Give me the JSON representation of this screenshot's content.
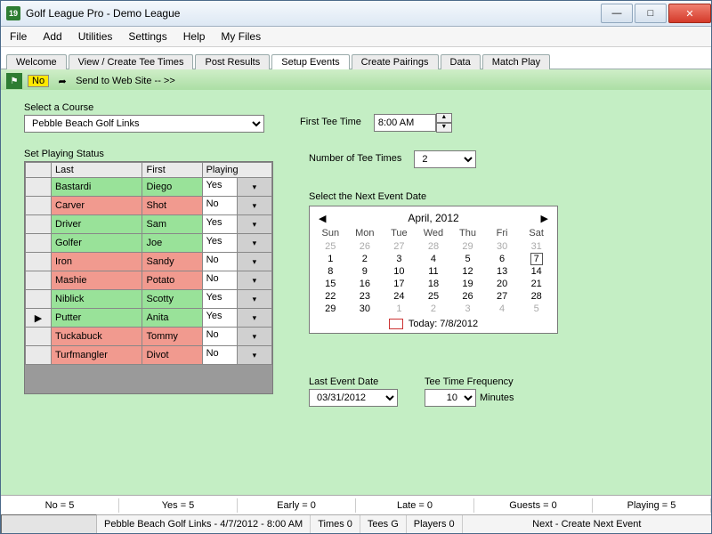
{
  "window": {
    "title": "Golf League Pro - Demo League",
    "icon_text": "19"
  },
  "menubar": [
    "File",
    "Add",
    "Utilities",
    "Settings",
    "Help",
    "My Files"
  ],
  "tabs": [
    "Welcome",
    "View / Create Tee Times",
    "Post Results",
    "Setup Events",
    "Create Pairings",
    "Data",
    "Match Play"
  ],
  "active_tab": "Setup Events",
  "toolbar": {
    "no_label": "No",
    "send_label": "Send to Web Site -- >>"
  },
  "form": {
    "course_label": "Select a Course",
    "course_value": "Pebble Beach Golf Links",
    "first_tee_label": "First Tee Time",
    "first_tee_value": "8:00 AM",
    "num_tees_label": "Number of Tee Times",
    "num_tees_value": "2",
    "status_label": "Set Playing Status",
    "next_date_label": "Select the Next Event Date",
    "last_event_label": "Last Event Date",
    "last_event_value": "03/31/2012",
    "freq_label": "Tee Time Frequency",
    "freq_value": "10",
    "freq_unit": "Minutes"
  },
  "grid": {
    "headers": [
      "Last",
      "First",
      "Playing"
    ],
    "rows": [
      {
        "last": "Bastardi",
        "first": "Diego",
        "playing": "Yes",
        "status": "yes"
      },
      {
        "last": "Carver",
        "first": "Shot",
        "playing": "No",
        "status": "no"
      },
      {
        "last": "Driver",
        "first": "Sam",
        "playing": "Yes",
        "status": "yes"
      },
      {
        "last": "Golfer",
        "first": "Joe",
        "playing": "Yes",
        "status": "yes"
      },
      {
        "last": "Iron",
        "first": "Sandy",
        "playing": "No",
        "status": "no"
      },
      {
        "last": "Mashie",
        "first": "Potato",
        "playing": "No",
        "status": "no"
      },
      {
        "last": "Niblick",
        "first": "Scotty",
        "playing": "Yes",
        "status": "yes"
      },
      {
        "last": "Putter",
        "first": "Anita",
        "playing": "Yes",
        "status": "yes",
        "marker": true
      },
      {
        "last": "Tuckabuck",
        "first": "Tommy",
        "playing": "No",
        "status": "no"
      },
      {
        "last": "Turfmangler",
        "first": "Divot",
        "playing": "No",
        "status": "no"
      }
    ]
  },
  "calendar": {
    "title": "April, 2012",
    "dow": [
      "Sun",
      "Mon",
      "Tue",
      "Wed",
      "Thu",
      "Fri",
      "Sat"
    ],
    "weeks": [
      [
        {
          "d": "25",
          "dim": true
        },
        {
          "d": "26",
          "dim": true
        },
        {
          "d": "27",
          "dim": true
        },
        {
          "d": "28",
          "dim": true
        },
        {
          "d": "29",
          "dim": true
        },
        {
          "d": "30",
          "dim": true
        },
        {
          "d": "31",
          "dim": true
        }
      ],
      [
        {
          "d": "1"
        },
        {
          "d": "2"
        },
        {
          "d": "3"
        },
        {
          "d": "4"
        },
        {
          "d": "5"
        },
        {
          "d": "6"
        },
        {
          "d": "7",
          "sel": true
        }
      ],
      [
        {
          "d": "8"
        },
        {
          "d": "9"
        },
        {
          "d": "10"
        },
        {
          "d": "11"
        },
        {
          "d": "12"
        },
        {
          "d": "13"
        },
        {
          "d": "14"
        }
      ],
      [
        {
          "d": "15"
        },
        {
          "d": "16"
        },
        {
          "d": "17"
        },
        {
          "d": "18"
        },
        {
          "d": "19"
        },
        {
          "d": "20"
        },
        {
          "d": "21"
        }
      ],
      [
        {
          "d": "22"
        },
        {
          "d": "23"
        },
        {
          "d": "24"
        },
        {
          "d": "25"
        },
        {
          "d": "26"
        },
        {
          "d": "27"
        },
        {
          "d": "28"
        }
      ],
      [
        {
          "d": "29"
        },
        {
          "d": "30"
        },
        {
          "d": "1",
          "dim": true
        },
        {
          "d": "2",
          "dim": true
        },
        {
          "d": "3",
          "dim": true
        },
        {
          "d": "4",
          "dim": true
        },
        {
          "d": "5",
          "dim": true
        }
      ]
    ],
    "today_label": "Today: 7/8/2012"
  },
  "counts": {
    "no": "No = 5",
    "yes": "Yes = 5",
    "early": "Early = 0",
    "late": "Late = 0",
    "guests": "Guests = 0",
    "playing": "Playing = 5"
  },
  "status": {
    "main": "Pebble Beach Golf Links - 4/7/2012 - 8:00 AM",
    "times": "Times 0",
    "tees": "Tees G",
    "players": "Players 0",
    "next": "Next - Create Next Event"
  }
}
